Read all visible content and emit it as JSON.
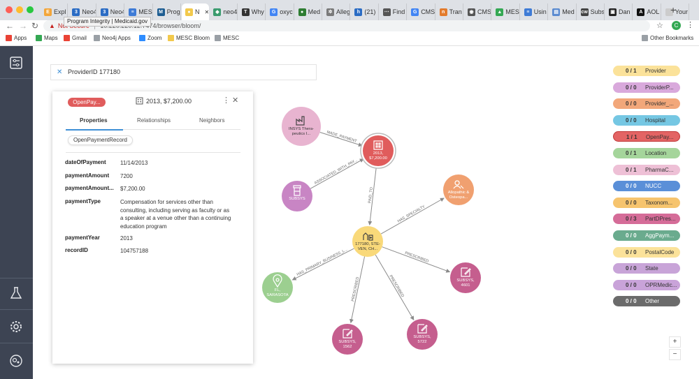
{
  "browser": {
    "tabs": [
      {
        "label": "Expl",
        "color": "#f3a63b",
        "glyph": "E"
      },
      {
        "label": "Neo4",
        "color": "#2b6cc4",
        "glyph": "3"
      },
      {
        "label": "Neo4",
        "color": "#2b6cc4",
        "glyph": "3"
      },
      {
        "label": "MES",
        "color": "#3e7bd6",
        "glyph": "≡"
      },
      {
        "label": "Prog",
        "color": "#1d5d92",
        "glyph": "M"
      },
      {
        "label": "N",
        "color": "#f2c94c",
        "glyph": "●"
      },
      {
        "label": "neo4",
        "color": "#3a9b6e",
        "glyph": "◆"
      },
      {
        "label": "Why",
        "color": "#333333",
        "glyph": "T"
      },
      {
        "label": "oxyc",
        "color": "#4285f4",
        "glyph": "G"
      },
      {
        "label": "Med",
        "color": "#2e7d32",
        "glyph": "●"
      },
      {
        "label": "Alleg",
        "color": "#7a7a7a",
        "glyph": "✲"
      },
      {
        "label": "(21)",
        "color": "#2b6cc4",
        "glyph": "h"
      },
      {
        "label": "Find",
        "color": "#555555",
        "glyph": "⋯"
      },
      {
        "label": "CMS",
        "color": "#4285f4",
        "glyph": "G"
      },
      {
        "label": "Tran",
        "color": "#e37b2c",
        "glyph": "n"
      },
      {
        "label": "CMS",
        "color": "#555555",
        "glyph": "◉"
      },
      {
        "label": "MES",
        "color": "#34a853",
        "glyph": "▲"
      },
      {
        "label": "Usin",
        "color": "#3e7bd6",
        "glyph": "≡"
      },
      {
        "label": "Med",
        "color": "#5b8bd0",
        "glyph": "▤"
      },
      {
        "label": "Subs",
        "color": "#444444",
        "glyph": "cw"
      },
      {
        "label": "Dan",
        "color": "#222222",
        "glyph": "▣"
      },
      {
        "label": "AOL",
        "color": "#111111",
        "glyph": "A"
      },
      {
        "label": "Your",
        "color": "#cccccc",
        "glyph": ""
      }
    ],
    "tooltip": "Program Integrity | Medicaid.gov",
    "url_warning": "Not Secure",
    "url": "10.220.220.12:7474/browser/bloom/",
    "profile_initial": "C",
    "bookmarks": [
      {
        "label": "Apps",
        "color": "#e94235"
      },
      {
        "label": "Maps",
        "color": "#34a853"
      },
      {
        "label": "Gmail",
        "color": "#ea4335"
      },
      {
        "label": "Neo4j Apps",
        "color": "#9aa0a6"
      },
      {
        "label": "Zoom",
        "color": "#2d8cff"
      },
      {
        "label": "MESC Bloom",
        "color": "#f2c94c"
      },
      {
        "label": "MESC",
        "color": "#9aa0a6"
      }
    ],
    "other_bookmarks": "Other Bookmarks"
  },
  "search": {
    "query": "ProviderID 177180"
  },
  "inspector": {
    "label_badge": "OpenPay...",
    "title": "2013, $7,200.00",
    "tabs": [
      "Properties",
      "Relationships",
      "Neighbors"
    ],
    "label_chip": "OpenPaymentRecord",
    "properties": [
      {
        "key": "dateOfPayment",
        "value": "11/14/2013"
      },
      {
        "key": "paymentAmount",
        "value": "7200"
      },
      {
        "key": "paymentAmount...",
        "value": "$7,200.00"
      },
      {
        "key": "paymentType",
        "value": "Compensation for services other than consulting, including serving as faculty or as a speaker at a venue other than a continuing education program"
      },
      {
        "key": "paymentYear",
        "value": "2013"
      },
      {
        "key": "recordID",
        "value": "104757188"
      }
    ]
  },
  "graph": {
    "nodes": [
      {
        "id": "insys",
        "lines": [
          "INSYS Thera-",
          "peutics I..."
        ],
        "color": "#e8b4d0",
        "icon": "factory"
      },
      {
        "id": "payment",
        "lines": [
          "2013,",
          "$7,200.00"
        ],
        "color": "#e05c5c",
        "icon": "building",
        "selected": true
      },
      {
        "id": "subsys_drug",
        "lines": [
          "SUBSYS"
        ],
        "color": "#c885c4",
        "icon": "pill"
      },
      {
        "id": "specialty",
        "lines": [
          "Allopathic &",
          "Osteopa..."
        ],
        "color": "#f0a070",
        "icon": "person-search"
      },
      {
        "id": "provider",
        "lines": [
          "177180, STE-",
          "VEN, CH..."
        ],
        "color": "#f9d97a",
        "icon": "provider"
      },
      {
        "id": "location",
        "lines": [
          "FL,",
          "SARASOTA"
        ],
        "color": "#9ccf90",
        "icon": "pin"
      },
      {
        "id": "subsys4601",
        "lines": [
          "SUBSYS,",
          "4601"
        ],
        "color": "#c55e8e",
        "icon": "edit"
      },
      {
        "id": "subsys1562",
        "lines": [
          "SUBSYS,",
          "1562"
        ],
        "color": "#c55e8e",
        "icon": "edit"
      },
      {
        "id": "subsys5722",
        "lines": [
          "SUBSYS,",
          "5722"
        ],
        "color": "#c55e8e",
        "icon": "edit"
      }
    ],
    "edges": [
      {
        "from": "insys",
        "to": "payment",
        "label": "MADE_PAYMENT"
      },
      {
        "from": "subsys_drug",
        "to": "payment",
        "label": "ASSOCIATED_WITH_PAY..."
      },
      {
        "from": "payment",
        "to": "provider",
        "label": "PAID_TO"
      },
      {
        "from": "provider",
        "to": "specialty",
        "label": "HAS_SPECIALTY"
      },
      {
        "from": "provider",
        "to": "location",
        "label": "HAS_PRIMARY_BUSINESS_L..."
      },
      {
        "from": "provider",
        "to": "subsys4601",
        "label": "PRESCRIBED"
      },
      {
        "from": "provider",
        "to": "subsys1562",
        "label": "PRESCRIBED"
      },
      {
        "from": "provider",
        "to": "subsys5722",
        "label": "PRESCRIBED"
      }
    ]
  },
  "legend": [
    {
      "count": "0 / 1",
      "name": "Provider",
      "color": "#fbe29a"
    },
    {
      "count": "0 / 0",
      "name": "ProviderP...",
      "color": "#d9a9dc"
    },
    {
      "count": "0 / 0",
      "name": "Provider_...",
      "color": "#f2a77a"
    },
    {
      "count": "0 / 0",
      "name": "Hospital",
      "color": "#75c7e3"
    },
    {
      "count": "1 / 1",
      "name": "OpenPay...",
      "color": "#e36464"
    },
    {
      "count": "0 / 1",
      "name": "Location",
      "color": "#a5d59b"
    },
    {
      "count": "0 / 1",
      "name": "PharmaC...",
      "color": "#eec0d6"
    },
    {
      "count": "0 / 0",
      "name": "NUCC",
      "color": "#5a8fd8"
    },
    {
      "count": "0 / 0",
      "name": "Taxonom...",
      "color": "#f6c46e"
    },
    {
      "count": "0 / 3",
      "name": "PartDPres...",
      "color": "#d56c98"
    },
    {
      "count": "0 / 0",
      "name": "AggPaym...",
      "color": "#6aab8e"
    },
    {
      "count": "0 / 0",
      "name": "PostalCode",
      "color": "#fbe29a"
    },
    {
      "count": "0 / 0",
      "name": "State",
      "color": "#c8a4d8"
    },
    {
      "count": "0 / 0",
      "name": "OPRMedic...",
      "color": "#c9a3d9"
    },
    {
      "count": "0 / 0",
      "name": "Other",
      "color": "#6b6b6b"
    }
  ],
  "zoom": {
    "in": "+",
    "out": "−"
  }
}
